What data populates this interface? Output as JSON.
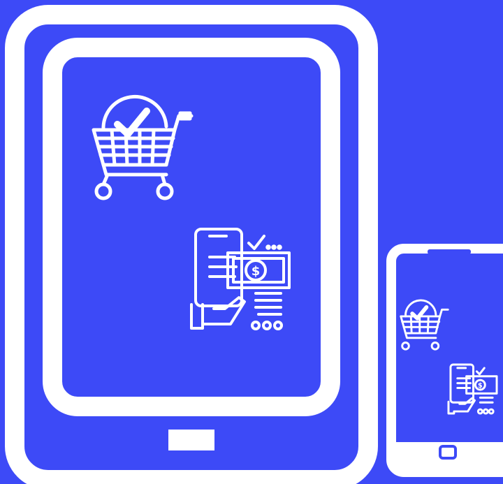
{
  "illustration": {
    "background_color": "#3d4af7",
    "line_color": "#ffffff",
    "tablet": {
      "icons": [
        "shopping-cart-check-icon",
        "mobile-payment-icon"
      ]
    },
    "phone": {
      "icons": [
        "shopping-cart-check-icon",
        "mobile-payment-icon"
      ]
    }
  }
}
